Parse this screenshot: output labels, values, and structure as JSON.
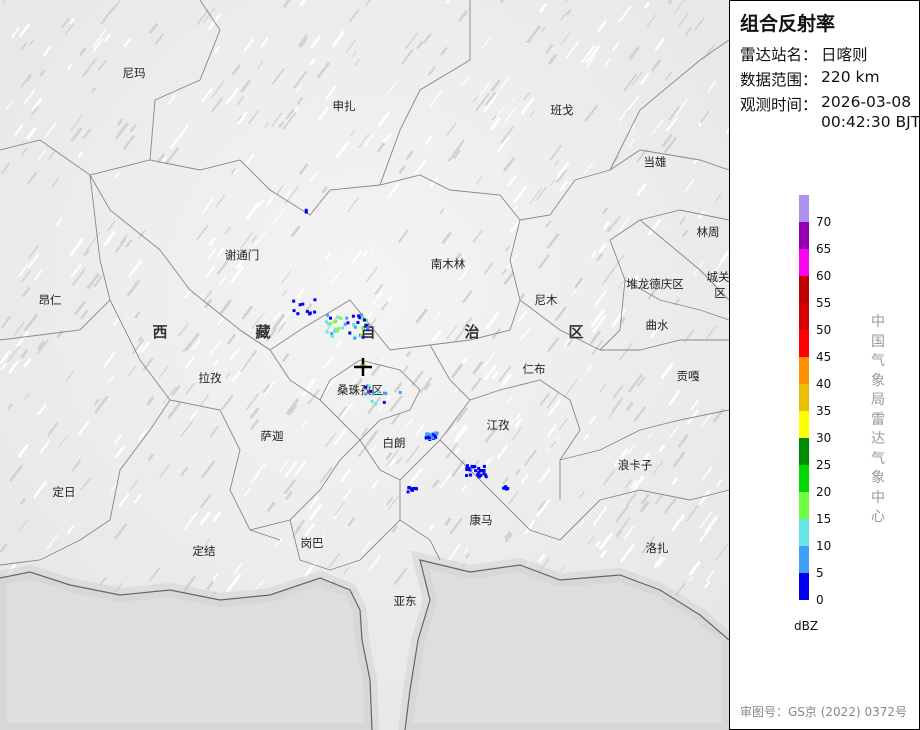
{
  "panel": {
    "title": "组合反射率",
    "station_label": "雷达站名：",
    "station": "日喀则",
    "range_label": "数据范围：",
    "range": "220 km",
    "time_label": "观测时间：",
    "date": "2026-03-08",
    "time": "00:42:30 BJT",
    "agency": "中国气象局雷达气象中心",
    "footer": "审图号：GS京 (2022) 0372号"
  },
  "legend": {
    "unit": "dBZ",
    "ticks": [
      "70",
      "65",
      "60",
      "55",
      "50",
      "45",
      "40",
      "35",
      "30",
      "25",
      "20",
      "15",
      "10",
      "5",
      "0"
    ],
    "colors": [
      "#ad90f0",
      "#9600b4",
      "#ff00f0",
      "#c00000",
      "#d60000",
      "#ff0000",
      "#ff9000",
      "#e8c000",
      "#ffff00",
      "#008c00",
      "#00d800",
      "#70ff40",
      "#66e6e6",
      "#40a0f8",
      "#0000f6"
    ]
  },
  "map": {
    "region_name": [
      "西",
      "藏",
      "自",
      "治",
      "区"
    ],
    "places": [
      "尼玛",
      "申扎",
      "班戈",
      "当雄",
      "林周",
      "谢通门",
      "南木林",
      "堆龙德庆区",
      "城关",
      "区",
      "昂仁",
      "尼木",
      "曲水",
      "拉孜",
      "桑珠孜区",
      "仁布",
      "贡嘎",
      "萨迦",
      "白朗",
      "江孜",
      "浪卡子",
      "定日",
      "康马",
      "定结",
      "岗巴",
      "洛扎",
      "亚东"
    ],
    "radar_site_icon": "crosshair-icon"
  }
}
